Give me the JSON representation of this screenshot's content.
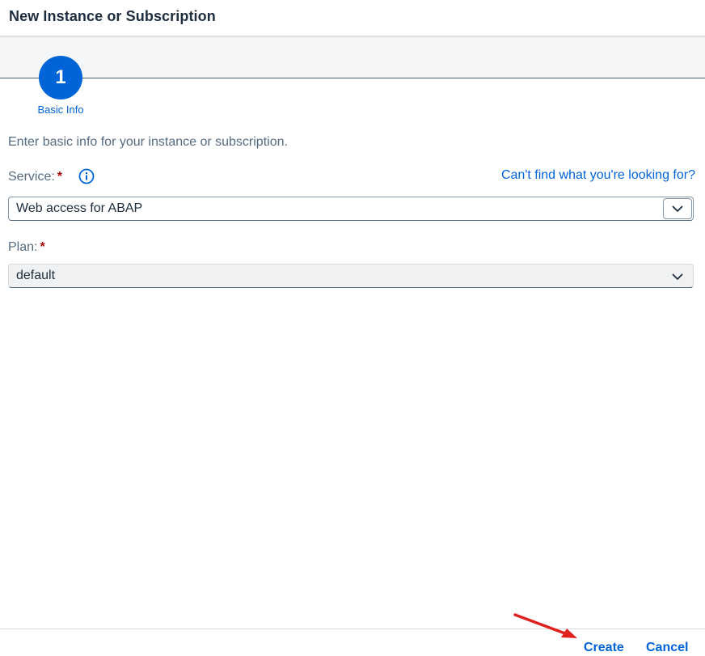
{
  "dialog": {
    "title": "New Instance or Subscription"
  },
  "wizard": {
    "step_number": "1",
    "step_label": "Basic Info"
  },
  "form": {
    "intro": "Enter basic info for your instance or subscription.",
    "service_label": "Service:",
    "service_value": "Web access for ABAP",
    "help_link": "Can't find what you're looking for?",
    "plan_label": "Plan:",
    "plan_value": "default",
    "required_marker": "*"
  },
  "footer": {
    "create_label": "Create",
    "cancel_label": "Cancel"
  },
  "colors": {
    "accent": "#0064d9",
    "required": "#aa0808",
    "annotation": "#e0221f"
  },
  "icons": {
    "info": "info-icon",
    "dropdown": "chevron-down-icon",
    "annotation": "arrow-annotation-icon"
  }
}
